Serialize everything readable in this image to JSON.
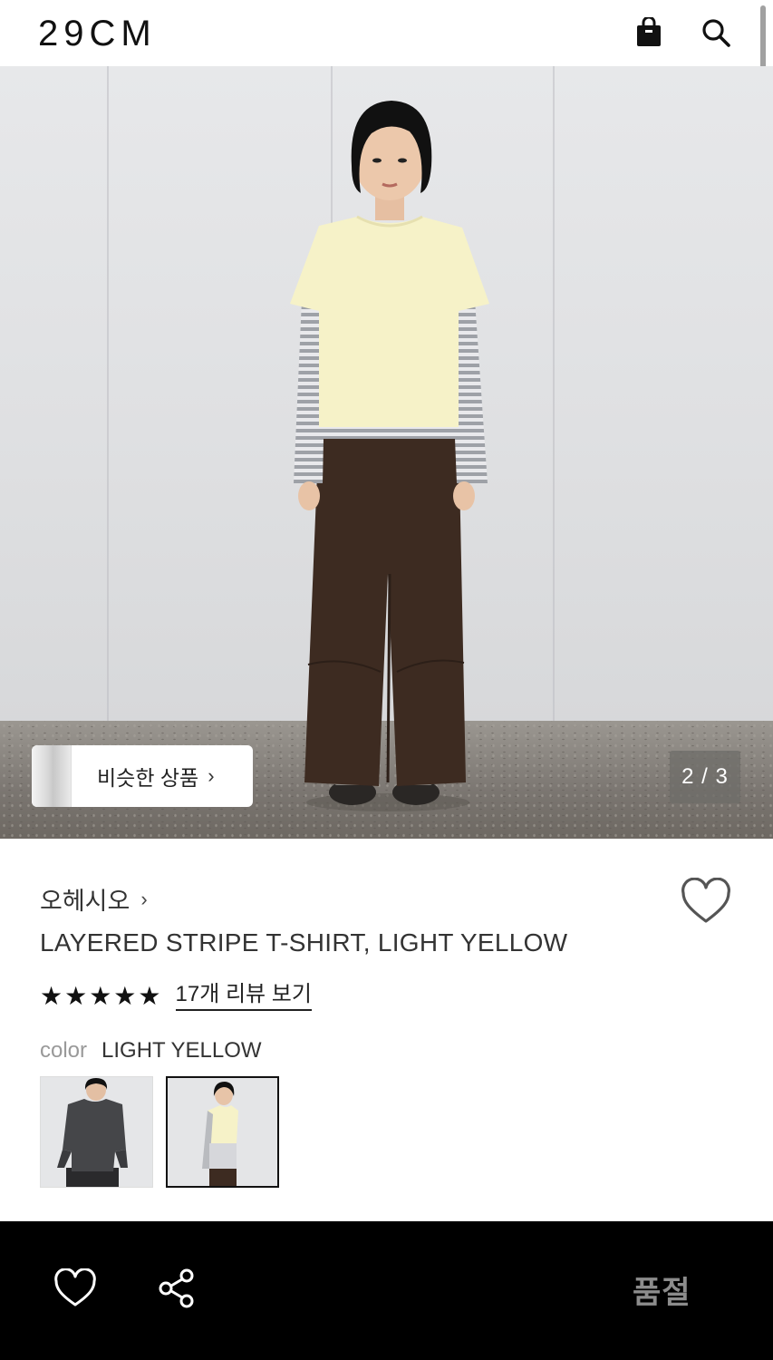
{
  "header": {
    "logo": "29CM",
    "icons": [
      "shopping-bag-icon",
      "search-icon"
    ]
  },
  "hero": {
    "similar_products_label": "비슷한 상품",
    "similar_chevron": "›",
    "image_counter": "2 / 3",
    "current_index": 2,
    "total_images": 3
  },
  "product": {
    "brand": "오헤시오",
    "brand_chevron": "›",
    "title": "LAYERED STRIPE T-SHIRT, LIGHT YELLOW",
    "stars_display": "★★★★★",
    "rating": 5,
    "review_link": "17개 리뷰 보기",
    "color_key": "color",
    "color_value": "LIGHT YELLOW",
    "swatches": [
      {
        "color": "charcoal",
        "selected": false
      },
      {
        "color": "light yellow",
        "selected": true
      }
    ]
  },
  "bottom_bar": {
    "soldout_label": "품절",
    "icons": [
      "heart-icon",
      "share-icon"
    ]
  },
  "colors": {
    "accent": "#000000",
    "bottom_bar_bg": "#000000",
    "soldout_text": "#8c8c8c",
    "shirt_yellow": "#f6f2c8",
    "pants_brown": "#3b2a20"
  }
}
